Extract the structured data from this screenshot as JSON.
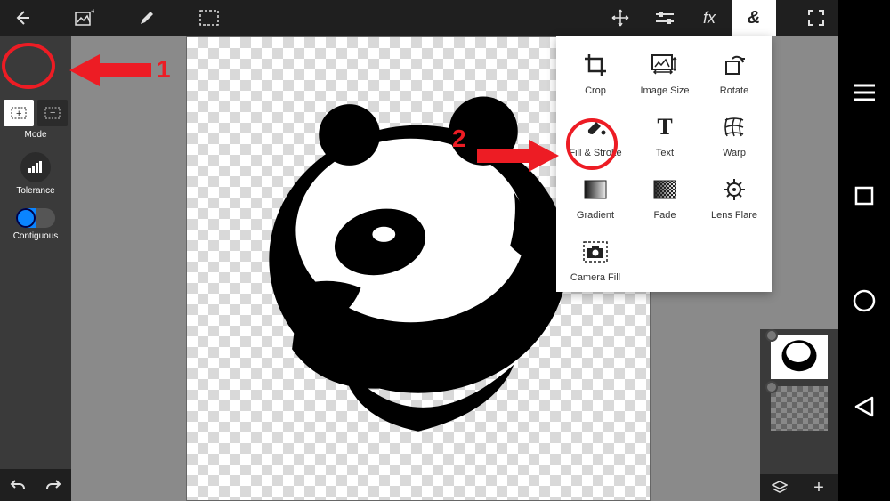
{
  "annotations": {
    "step1": "1",
    "step2": "2"
  },
  "sidebar": {
    "mode_label": "Mode",
    "tolerance_label": "Tolerance",
    "contiguous_label": "Contiguous"
  },
  "topbar_icons": {
    "back": "back-icon",
    "add_image": "add-image-icon",
    "draw": "pencil-icon",
    "marquee": "marquee-icon",
    "move": "move-icon",
    "adjust": "sliders-icon",
    "fx": "fx-icon",
    "ampersand": "ampersand-icon",
    "crop_full": "crop-full-icon"
  },
  "menu": {
    "items": [
      {
        "key": "crop",
        "label": "Crop"
      },
      {
        "key": "image_size",
        "label": "Image Size"
      },
      {
        "key": "rotate",
        "label": "Rotate"
      },
      {
        "key": "fill_stroke",
        "label": "Fill & Stroke"
      },
      {
        "key": "text",
        "label": "Text"
      },
      {
        "key": "warp",
        "label": "Warp"
      },
      {
        "key": "gradient",
        "label": "Gradient"
      },
      {
        "key": "fade",
        "label": "Fade"
      },
      {
        "key": "lens_flare",
        "label": "Lens Flare"
      },
      {
        "key": "camera_fill",
        "label": "Camera Fill"
      }
    ]
  },
  "colors": {
    "annotation": "#ed1c24",
    "toolbar_bg": "#1f1f1f",
    "panel_bg": "#3a3a3a"
  }
}
